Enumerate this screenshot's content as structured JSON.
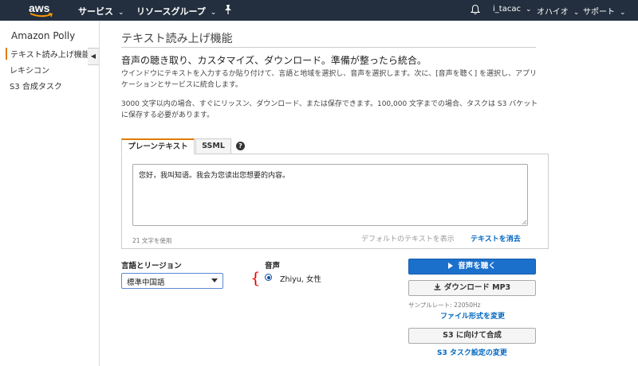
{
  "topnav": {
    "logo": "aws",
    "services": "サービス",
    "resource_groups": "リソースグループ",
    "user": "i_tacac",
    "region": "オハイオ",
    "support": "サポート",
    "icons": [
      "aws-logo",
      "chevron-down-icon",
      "pin-icon",
      "bell-icon"
    ]
  },
  "sidebar": {
    "title": "Amazon Polly",
    "items": [
      {
        "label": "テキスト読み上げ機能",
        "active": true
      },
      {
        "label": "レキシコン",
        "active": false
      },
      {
        "label": "S3 合成タスク",
        "active": false
      }
    ],
    "collapse_icon": "◀"
  },
  "main": {
    "page_title": "テキスト読み上げ機能",
    "subheading": "音声の聴き取り、カスタマイズ、ダウンロード。準備が整ったら統合。",
    "description_1": "ウインドウにテキストを入力するか貼り付けて、言語と地域を選択し、音声を選択します。次に、[音声を聴く] を選択し、アプリケーションとサービスに統合します。",
    "description_2": "3000 文字以内の場合、すぐにリッスン、ダウンロード、または保存できます。100,000 文字までの場合、タスクは S3 バケットに保存する必要があります。",
    "tabs": [
      {
        "label": "プレーンテキスト",
        "active": true
      },
      {
        "label": "SSML",
        "active": false
      }
    ],
    "help_icon": "?",
    "text_input": "您好，我叫知语。我会为您读出您想要的内容。",
    "char_count": "21 文字を使用",
    "default_text_link": "デフォルトのテキストを表示",
    "clear_text_link": "テキストを消去",
    "language_label": "言語とリージョン",
    "language_value": "標準中国語",
    "voice_label": "音声",
    "voice_name": "Zhiyu, 女性",
    "listen_button": "音声を聴く",
    "download_button": "ダウンロード MP3",
    "sample_rate": "サンプルレート: 22050Hz",
    "file_format_link": "ファイル形式を変更",
    "synthesize_s3_button": "S3 に向けて合成",
    "s3_task_settings_link": "S3 タスク設定の変更"
  },
  "colors": {
    "nav_bg": "#232f3e",
    "accent_orange": "#e07b00",
    "primary_blue": "#1b70cc",
    "link_blue": "#0066c0",
    "annotation_red": "#e00000"
  }
}
